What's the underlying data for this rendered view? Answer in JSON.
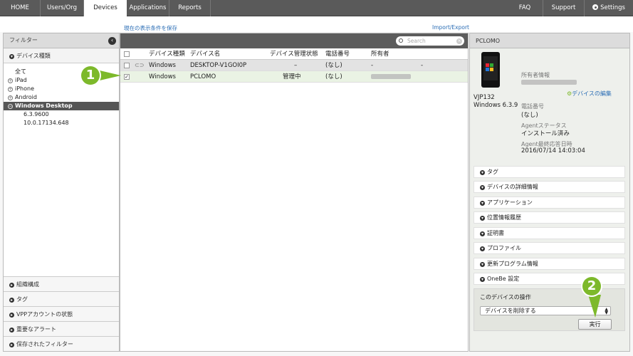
{
  "nav": {
    "tabs": [
      "HOME",
      "Users/Org",
      "Devices",
      "Applications",
      "Reports"
    ],
    "right_tabs": [
      "FAQ",
      "Support",
      "Settings"
    ]
  },
  "links": {
    "save_filter": "現在の表示条件を保存",
    "import_export": "Import/Export"
  },
  "filter": {
    "title": "フィルター",
    "device_type_header": "デバイス種類",
    "items": [
      "全て",
      "iPad",
      "iPhone",
      "Android",
      "Windows Desktop",
      "6.3.9600",
      "10.0.17134.648"
    ],
    "bottom_sections": [
      "組織構成",
      "タグ",
      "VPPアカウントの状態",
      "重要なアラート",
      "保存されたフィルター"
    ]
  },
  "search": {
    "placeholder": "Search"
  },
  "table": {
    "headers": [
      "デバイス種類",
      "デバイス名",
      "デバイス管理状態",
      "電話番号",
      "所有者"
    ],
    "rows": [
      {
        "type": "Windows",
        "name": "DESKTOP-V1GOI0P",
        "status": "–",
        "phone": "(なし)",
        "owner": "-",
        "extra": "-"
      },
      {
        "type": "Windows",
        "name": "PCLOMO",
        "status": "管理中",
        "phone": "(なし)",
        "owner": "",
        "extra": ""
      }
    ]
  },
  "detail": {
    "title": "PCLOMO",
    "model": "VJP132",
    "os": "Windows 6.3.9",
    "owner_label": "所有者情報",
    "edit_link": "デバイスの編集",
    "phone_label": "電話番号",
    "phone_value": "(なし)",
    "agent_status_label": "Agentステータス",
    "agent_status_value": "インストール済み",
    "agent_last_label": "Agent最終応答日時",
    "agent_last_value": "2016/07/14 14:03:04",
    "sections": [
      "タグ",
      "デバイスの詳細情報",
      "アプリケーション",
      "位置情報履歴",
      "証明書",
      "プロファイル",
      "更新プログラム情報",
      "OneBe 設定"
    ],
    "ops_title": "このデバイスの操作",
    "ops_select": "デバイスを削除する",
    "exec_label": "実行"
  },
  "callouts": [
    "1",
    "2"
  ],
  "colors": {
    "accent": "#7db92b",
    "nav": "#5a5a5a",
    "link": "#2a6db5"
  }
}
